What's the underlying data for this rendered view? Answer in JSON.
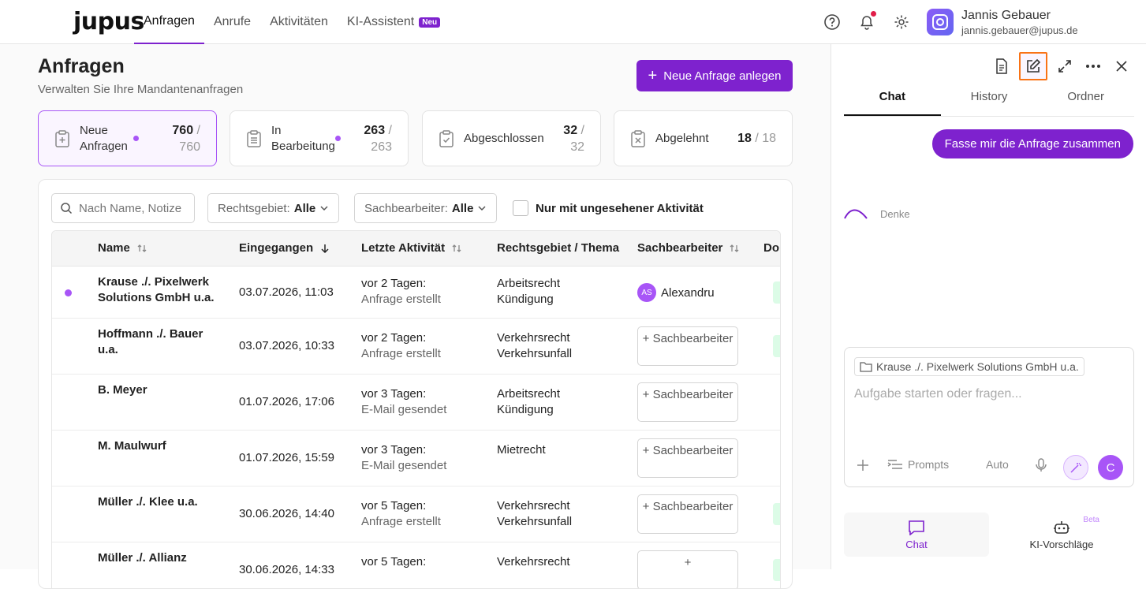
{
  "app": {
    "logo": "jupus",
    "nav": [
      {
        "label": "Anfragen",
        "active": true
      },
      {
        "label": "Anrufe"
      },
      {
        "label": "Aktivitäten"
      },
      {
        "label": "KI-Assistent",
        "badge": "Neu"
      }
    ],
    "user": {
      "name": "Jannis Gebauer",
      "email": "jannis.gebauer@jupus.de"
    },
    "icons": [
      "help-icon",
      "bell-icon",
      "gear-icon"
    ],
    "accent": "#7e22ce"
  },
  "page": {
    "title": "Anfragen",
    "subtitle": "Verwalten Sie Ihre Mandantenanfragen",
    "new_button": "Neue Anfrage anlegen"
  },
  "stats": [
    {
      "label": "Neue Anfragen",
      "count": "760",
      "total": "/ 760",
      "dot": true
    },
    {
      "label": "In Bearbeitung",
      "count": "263",
      "total": "/ 263",
      "dot": true
    },
    {
      "label": "Abgeschlossen",
      "count": "32",
      "total": "/ 32"
    },
    {
      "label": "Abgelehnt",
      "count": "18",
      "total": "/ 18"
    }
  ],
  "filters": {
    "search_placeholder": "Nach Name, Notizen",
    "rechtsgebiet_label": "Rechtsgebiet:",
    "rechtsgebiet_value": "Alle",
    "sachbearbeiter_label": "Sachbearbeiter:",
    "sachbearbeiter_value": "Alle",
    "unseen_label": "Nur mit ungesehener Aktivität"
  },
  "table": {
    "columns": [
      "Name",
      "Eingegangen",
      "Letzte Aktivität",
      "Rechtsgebiet / Thema",
      "Sachbearbeiter",
      "Dol"
    ],
    "rows": [
      {
        "name": "Krause ./. Pixelwerk Solutions GmbH u.a.",
        "received": "03.07.2026, 11:03",
        "activity_when": "vor 2 Tagen:",
        "activity_what": "Anfrage erstellt",
        "area": "Arbeitsrecht",
        "topic": "Kündigung",
        "assignee": "Alexandru",
        "assignee_initials": "AS",
        "unread": true
      },
      {
        "name": "Hoffmann ./. Bauer u.a.",
        "received": "03.07.2026, 10:33",
        "activity_when": "vor 2 Tagen:",
        "activity_what": "Anfrage erstellt",
        "area": "Verkehrsrecht",
        "topic": "Verkehrsunfall",
        "assign_label": "+ Sachbearbeiter"
      },
      {
        "name": "B. Meyer",
        "received": "01.07.2026, 17:06",
        "activity_when": "vor 3 Tagen:",
        "activity_what": "E-Mail gesendet",
        "area": "Arbeitsrecht",
        "topic": "Kündigung",
        "assign_label": "+ Sachbearbeiter"
      },
      {
        "name": "M. Maulwurf",
        "received": "01.07.2026, 15:59",
        "activity_when": "vor 3 Tagen:",
        "activity_what": "E-Mail gesendet",
        "area": "Mietrecht",
        "topic": "",
        "assign_label": "+ Sachbearbeiter"
      },
      {
        "name": "Müller ./. Klee u.a.",
        "received": "30.06.2026, 14:40",
        "activity_when": "vor 5 Tagen:",
        "activity_what": "Anfrage erstellt",
        "area": "Verkehrsrecht",
        "topic": "Verkehrsunfall",
        "assign_label": "+ Sachbearbeiter"
      },
      {
        "name": "Müller ./. Allianz",
        "received": "30.06.2026, 14:33",
        "activity_when": "vor 5 Tagen:",
        "activity_what": "",
        "area": "Verkehrsrecht",
        "topic": "",
        "assign_label": "+"
      }
    ]
  },
  "panel": {
    "tabs": [
      "Chat",
      "History",
      "Ordner"
    ],
    "message": "Fasse mir die Anfrage zusammen",
    "thinking": "Denke",
    "context_chip": "Krause ./. Pixelwerk Solutions GmbH u.a.",
    "input_placeholder": "Aufgabe starten oder fragen...",
    "prompts_label": "Prompts",
    "mode_label": "Auto",
    "send_letter": "C",
    "bottom_nav": [
      {
        "label": "Chat",
        "active": true
      },
      {
        "label": "KI-Vorschläge",
        "badge": "Beta"
      }
    ]
  }
}
